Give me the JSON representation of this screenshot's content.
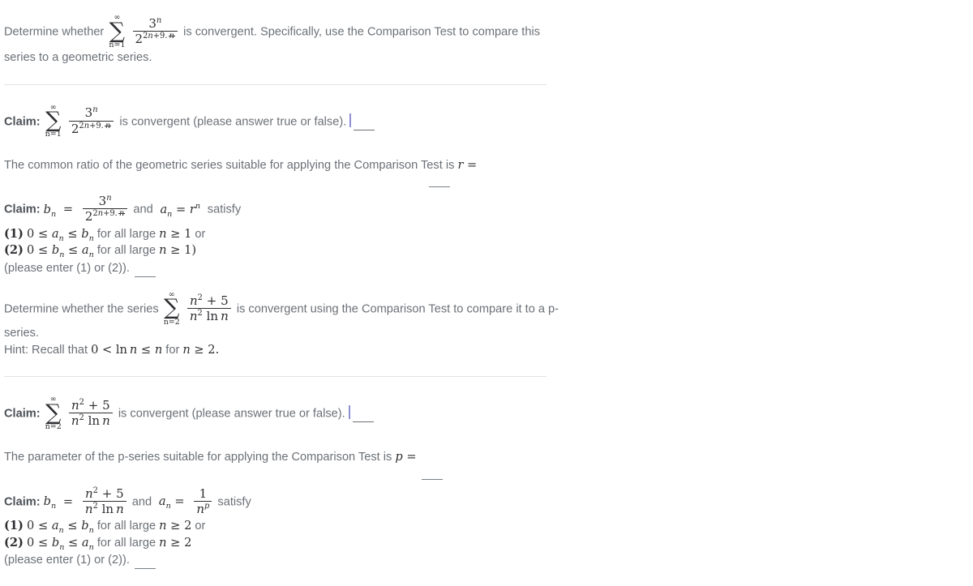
{
  "page": {
    "background": "#ffffff",
    "text_color": "#6b7076",
    "math_color": "#2f2f33",
    "caret_color": "#8f8fd4",
    "divider_color": "#e2e3e5"
  },
  "problem1": {
    "prompt_pre": "Determine whether",
    "prompt_mid": "is convergent. Specifically, use the Comparison Test to compare this",
    "prompt_post": "series to a geometric series.",
    "series": {
      "sum_top": "∞",
      "sum_bottom": "n=1",
      "numerator": "3^n",
      "denominator": "2^{2n+9·√n}"
    },
    "claim": {
      "label": "Claim:",
      "text": "is convergent (please answer true or false).",
      "answer_value": "",
      "focused": true
    },
    "ratio_line": {
      "text": "The common ratio of the geometric series suitable for applying the Comparison Test is",
      "symbol": "r =",
      "answer_value": ""
    },
    "claim2": {
      "label": "Claim:",
      "lhs": "b",
      "lhs_sub": "n",
      "eq": "=",
      "mid": "and",
      "rhs": "a",
      "rhs_sub": "n",
      "rhs_eq": "=",
      "rhs_expr": "r^n",
      "tail": "satisfy"
    },
    "conditions": {
      "option1": "(1) 0 ≤ aₙ ≤ bₙ for all large n ≥ 1 or",
      "option2": "(2) 0 ≤ bₙ ≤ aₙ for all large n ≥ 1)",
      "instruction": "(please enter (1) or (2)).",
      "answer_value": "",
      "n_bound": "1"
    }
  },
  "problem2": {
    "prompt_pre": "Determine whether the series",
    "prompt_mid": "is convergent using the Comparison Test to compare it to a p-",
    "prompt_post": "series.",
    "hint_pre": "Hint: Recall that",
    "hint_math": "0 < ln n ≤ n",
    "hint_mid": "for",
    "hint_bound": "n ≥ 2",
    "hint_end": ".",
    "series": {
      "sum_top": "∞",
      "sum_bottom": "n=2",
      "numerator": "n² + 5",
      "denominator": "n² ln n"
    },
    "claim": {
      "label": "Claim:",
      "text": "is convergent (please answer true or false).",
      "answer_value": "",
      "focused": true
    },
    "parameter_line": {
      "text": "The parameter of the p-series suitable for applying the Comparison Test is",
      "symbol": "p =",
      "answer_value": ""
    },
    "claim2": {
      "label": "Claim:",
      "lhs": "b",
      "lhs_sub": "n",
      "eq": "=",
      "mid": "and",
      "rhs": "a",
      "rhs_sub": "n",
      "rhs_eq": "=",
      "rhs_num": "1",
      "rhs_den": "n^p",
      "tail": "satisfy"
    },
    "conditions": {
      "option1": "(1) 0 ≤ aₙ ≤ bₙ for all large n ≥ 2 or",
      "option2": "(2) 0 ≤ bₙ ≤ aₙ for all large n ≥ 2",
      "instruction": "(please enter (1) or (2)).",
      "answer_value": "",
      "n_bound": "2"
    }
  }
}
